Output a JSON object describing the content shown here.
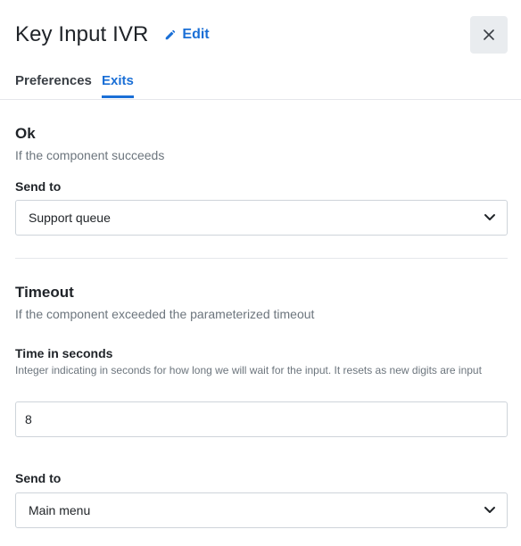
{
  "header": {
    "title": "Key Input IVR",
    "edit_label": "Edit"
  },
  "tabs": [
    {
      "label": "Preferences",
      "active": false
    },
    {
      "label": "Exits",
      "active": true
    }
  ],
  "exits": {
    "ok": {
      "title": "Ok",
      "description": "If the component succeeds",
      "send_to_label": "Send to",
      "send_to_value": "Support queue"
    },
    "timeout": {
      "title": "Timeout",
      "description": "If the component exceeded the parameterized timeout",
      "time_label": "Time in seconds",
      "time_help": "Integer indicating in seconds for how long we will wait for the input. It resets as new digits are input",
      "time_value": "8",
      "send_to_label": "Send to",
      "send_to_value": "Main menu"
    }
  },
  "colors": {
    "accent": "#1a6fd6",
    "close_bg": "#e9ecef",
    "border": "#ced4da"
  },
  "icons": {
    "edit": "pencil-icon",
    "close": "close-icon",
    "dropdown": "chevron-down-icon"
  }
}
